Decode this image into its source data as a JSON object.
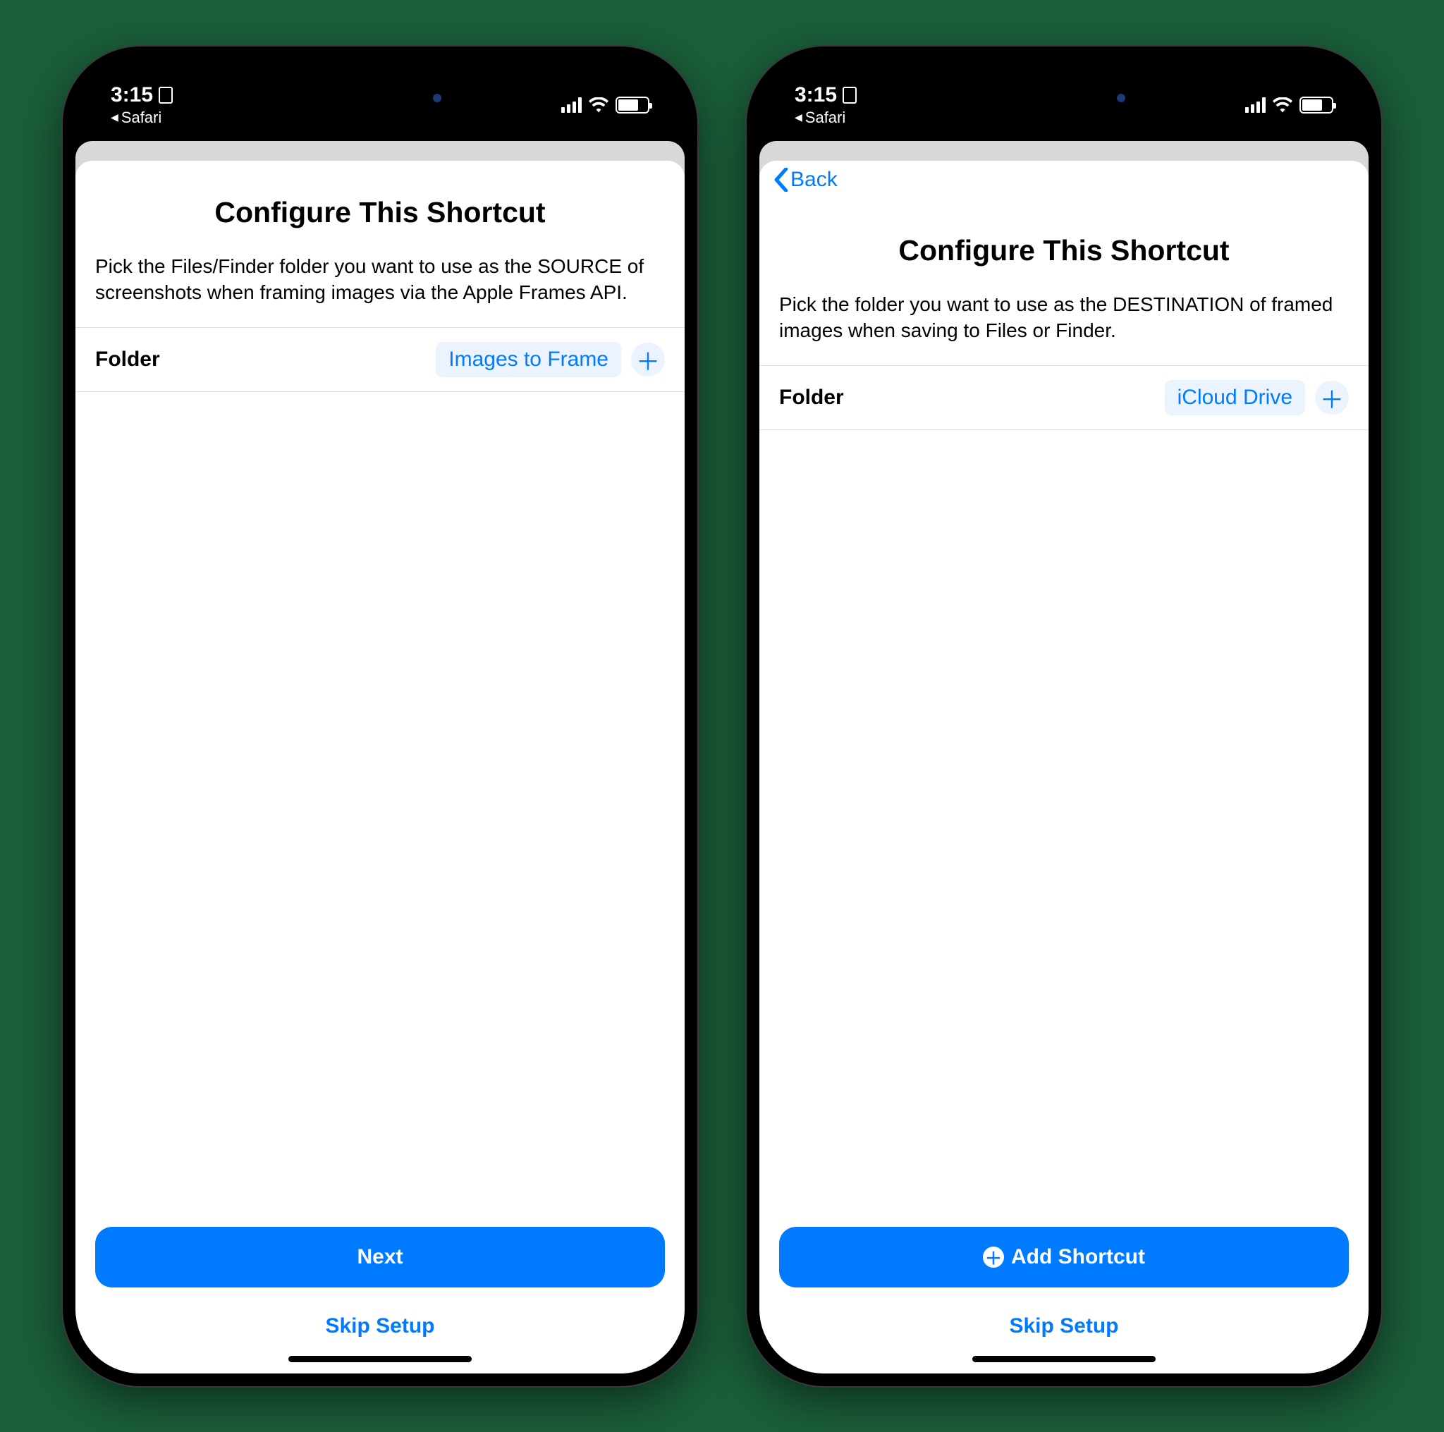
{
  "status": {
    "time": "3:15",
    "back_app": "Safari"
  },
  "phone1": {
    "title": "Configure This Shortcut",
    "description": "Pick the Files/Finder folder you want to use as the SOURCE of screenshots when framing images via the Apple Frames API.",
    "folder_label": "Folder",
    "folder_value": "Images to Frame",
    "primary_button": "Next",
    "skip": "Skip Setup"
  },
  "phone2": {
    "nav_back": "Back",
    "title": "Configure This Shortcut",
    "description": "Pick the folder you want to use as the DESTINATION of framed images when saving to Files or Finder.",
    "folder_label": "Folder",
    "folder_value": "iCloud Drive",
    "primary_button": "Add Shortcut",
    "skip": "Skip Setup"
  }
}
